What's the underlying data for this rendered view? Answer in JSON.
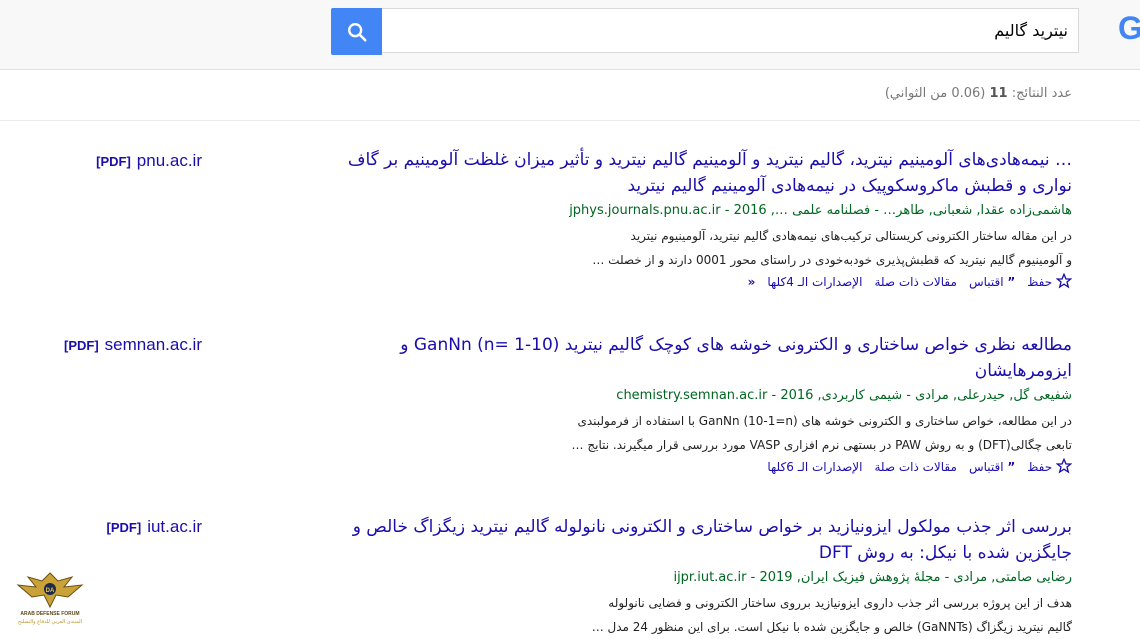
{
  "search": {
    "query": "نيترید گالیم"
  },
  "stats": {
    "prefix": "عدد النتائج:",
    "count": "11",
    "time": "(0.06 من الثواني)"
  },
  "results": [
    {
      "site": "pnu.ac.ir",
      "tag": "[PDF]",
      "title": "… نیمه‌هادی‌های آلومینیم نیترید، گالیم نیترید و آلومینیم گالیم نیترید و تأثیر میزان غلظت آلومینیم بر گاف نواری و قطبش ماکروسکوپیک در نیمه‌هادی آلومینیم گالیم نیترید",
      "meta": "هاشمی‌زاده عقدا, شعبانی, طاهر… - فصلنامه علمی …, 2016 - jphys.journals.pnu.ac.ir",
      "snippet1": "در این مقاله ساختار الکترونی ‌کریستالی ترکیب‌های نیمه‌هادی گالیم نیترید، آلومینیوم نیترید",
      "snippet2": "و آلومینیوم گالیم نیترید که قطبش‌پذیری خودبه‌خودی در راستای محور 0001 دارند و از خصلت …",
      "actions": {
        "save": "حفظ",
        "cite": "اقتباس",
        "related": "مقالات ذات صلة",
        "versions": "الإصدارات الـ 4كلها"
      }
    },
    {
      "site": "semnan.ac.ir",
      "tag": "[PDF]",
      "title": "مطالعه نظری خواص ساختاری و الکترونی خوشه های کوچک گالیم نیترید (GanNn (n= 1-10 و ایزومرهایشان",
      "meta": "شفیعی گل, حیدرعلی, مرادی - شیمی کاربردی, 2016 - chemistry.semnan.ac.ir",
      "snippet1": "در این مطالعه، خواص ساختاری و الکترونی خوشه های (GanNn (10-1=n با استفاده از فرمولبندی",
      "snippet2": "تابعی چگالی(DFT) و به روش PAW در بستهی نرم افزاری VASP مورد بررسی قرار میگیرند. نتایج …",
      "actions": {
        "save": "حفظ",
        "cite": "اقتباس",
        "related": "مقالات ذات صلة",
        "versions": "الإصدارات الـ 6كلها"
      }
    },
    {
      "site": "iut.ac.ir",
      "tag": "[PDF]",
      "title": "بررسی اثر جذب مولکول ایزونیازید بر خواص ساختاری و الکترونی نانولوله گالیم نیترید زیگزاگ خالص و جایگزین شده با نیکل: به روش DFT",
      "meta": "رضایی صامتی, مرادی - مجلهٔ پژوهش فیزیک ایران, 2019 - ijpr.iut.ac.ir",
      "snippet1": "هدف از این پروژه بررسی اثر جذب داروی ایزونیازید برروی ساختار الکترونی و فضایی نانولوله",
      "snippet2": "گالیم نیترید زیگزاگ (GaNNTs) خالص و جایگزین شده با نیکل است. برای این منظور 24 مدل …"
    }
  ],
  "watermark": {
    "line1": "ARAB DEFENSE FORUM",
    "line2": "المنتدى العربي للدفاع والتسليح"
  },
  "colors": {
    "link": "#1a0dab",
    "url": "#006621",
    "accent": "#4285f4"
  }
}
